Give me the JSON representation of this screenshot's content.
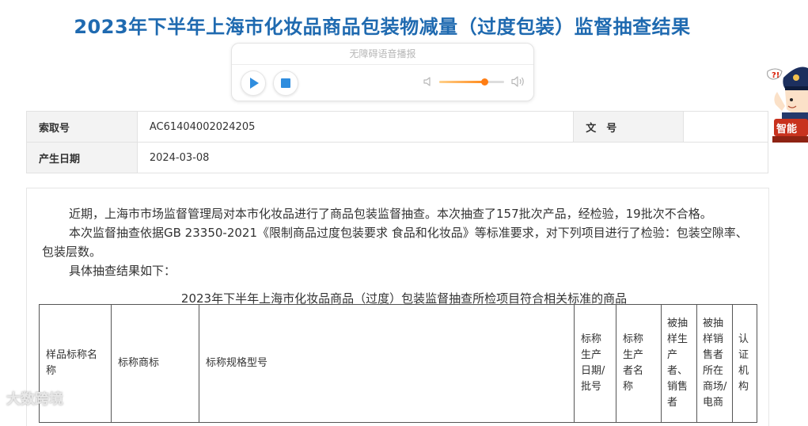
{
  "page": {
    "title": "2023年下半年上海市化妆品商品包装物减量（过度包装）监督抽查结果"
  },
  "player": {
    "label": "无障碍语音播报",
    "volume": 0.7
  },
  "assistant": {
    "label": "智能"
  },
  "meta": {
    "index_label": "索取号",
    "index_value": "AC61404002024205",
    "doc_label": "文　号",
    "doc_value": "",
    "date_label": "产生日期",
    "date_value": "2024-03-08"
  },
  "content": {
    "p1": "近期，上海市市场监督管理局对本市化妆品进行了商品包装监督抽查。本次抽查了157批次产品，经检验，19批次不合格。",
    "p2": "本次监督抽查依据GB 23350-2021《限制商品过度包装要求 食品和化妆品》等标准要求，对下列项目进行了检验：包装空隙率、包装层数。",
    "p3": "具体抽查结果如下：",
    "table_caption": "2023年下半年上海市化妆品商品（过度）包装监督抽查所检项目符合相关标准的商品"
  },
  "table": {
    "headers": [
      [
        "样品标称名",
        "称"
      ],
      [
        "标称商标"
      ],
      [
        "标称规格型号"
      ],
      [
        "标称",
        "生产",
        "日期/",
        "批号"
      ],
      [
        "标称",
        "生产",
        "者名",
        "称"
      ],
      [
        "被抽",
        "样生",
        "产",
        "者、",
        "销售",
        "者"
      ],
      [
        "被抽",
        "样销",
        "售者",
        "所在",
        "商场/",
        "电商"
      ],
      [
        "认",
        "证",
        "机",
        "构"
      ]
    ]
  },
  "watermark": {
    "text": "大数跨境"
  }
}
